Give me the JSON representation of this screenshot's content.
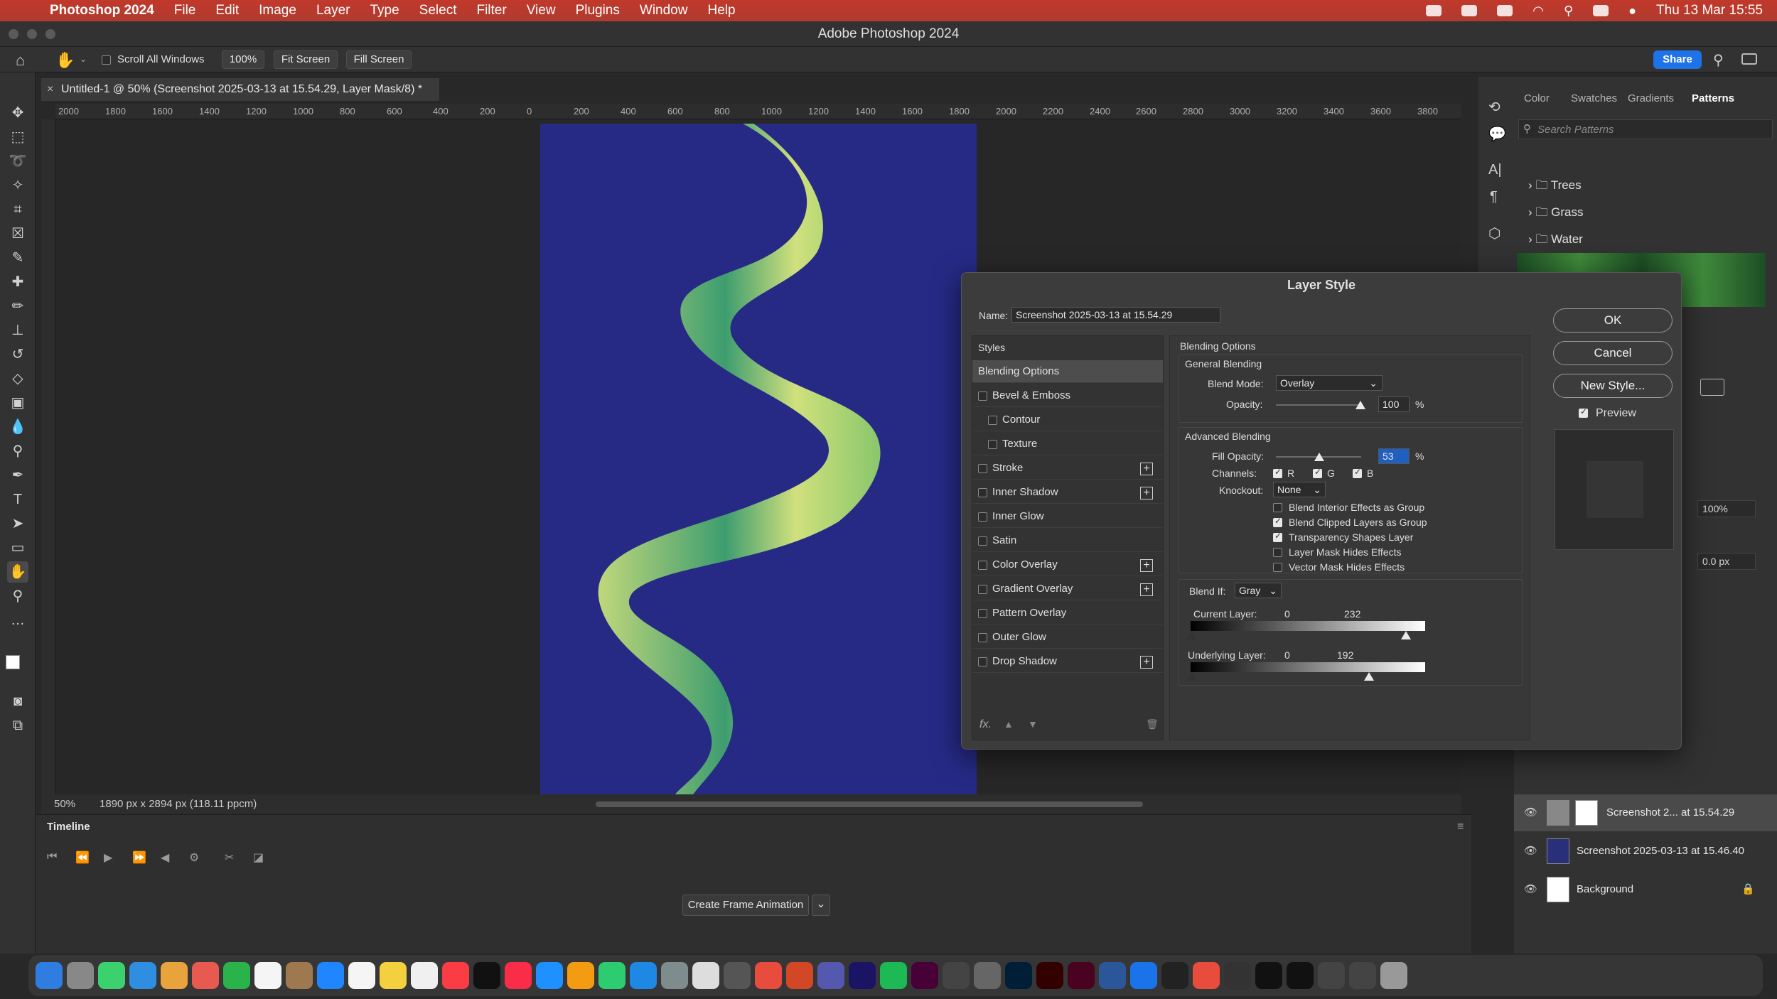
{
  "menubar": {
    "app_name": "Photoshop 2024",
    "menus": [
      "File",
      "Edit",
      "Image",
      "Layer",
      "Type",
      "Select",
      "Filter",
      "View",
      "Plugins",
      "Window",
      "Help"
    ],
    "clock": "Thu 13 Mar  15:55"
  },
  "window": {
    "title": "Adobe Photoshop 2024"
  },
  "options": {
    "scroll_all": "Scroll All Windows",
    "zoom": "100%",
    "fit_screen": "Fit Screen",
    "fill_screen": "Fill Screen",
    "share": "Share"
  },
  "document": {
    "tab_title": "Untitled-1 @ 50% (Screenshot 2025-03-13 at 15.54.29, Layer Mask/8) *",
    "zoom": "50%",
    "dimensions": "1890 px x 2894 px (118.11 ppcm)",
    "ruler_labels": [
      "2000",
      "1800",
      "1600",
      "1400",
      "1200",
      "1000",
      "800",
      "600",
      "400",
      "200",
      "0",
      "200",
      "400",
      "600",
      "800",
      "1000",
      "1200",
      "1400",
      "1600",
      "1800",
      "2000",
      "2200",
      "2400",
      "2600",
      "2800",
      "3000",
      "3200",
      "3400",
      "3600",
      "3800"
    ]
  },
  "timeline": {
    "title": "Timeline",
    "create_button": "Create Frame Animation"
  },
  "patterns_panel": {
    "tabs": [
      "Color",
      "Swatches",
      "Gradients",
      "Patterns"
    ],
    "search_placeholder": "Search Patterns",
    "folders": [
      "Trees",
      "Grass",
      "Water"
    ]
  },
  "properties_panel": {
    "opacity": "100%",
    "feather": "0.0 px"
  },
  "layers": [
    {
      "name": "Screenshot 2... at 15.54.29"
    },
    {
      "name": "Screenshot 2025-03-13 at 15.46.40"
    },
    {
      "name": "Background"
    }
  ],
  "dialog": {
    "title": "Layer Style",
    "name_label": "Name:",
    "name_value": "Screenshot 2025-03-13 at 15.54.29",
    "styles_header": "Styles",
    "styles": [
      {
        "label": "Blending Options",
        "selected": true
      },
      {
        "label": "Bevel & Emboss"
      },
      {
        "label": "Contour"
      },
      {
        "label": "Texture"
      },
      {
        "label": "Stroke"
      },
      {
        "label": "Inner Shadow"
      },
      {
        "label": "Inner Glow"
      },
      {
        "label": "Satin"
      },
      {
        "label": "Color Overlay"
      },
      {
        "label": "Gradient Overlay"
      },
      {
        "label": "Pattern Overlay"
      },
      {
        "label": "Outer Glow"
      },
      {
        "label": "Drop Shadow"
      }
    ],
    "ok": "OK",
    "cancel": "Cancel",
    "new_style": "New Style...",
    "preview": "Preview",
    "blending": {
      "section": "Blending Options",
      "general": "General Blending",
      "blend_mode_label": "Blend Mode:",
      "blend_mode": "Overlay",
      "opacity_label": "Opacity:",
      "opacity": "100",
      "advanced": "Advanced Blending",
      "fill_opacity_label": "Fill Opacity:",
      "fill_opacity": "53",
      "percent": "%",
      "channels_label": "Channels:",
      "channels": [
        "R",
        "G",
        "B"
      ],
      "knockout_label": "Knockout:",
      "knockout": "None",
      "options": [
        {
          "label": "Blend Interior Effects as Group",
          "checked": false
        },
        {
          "label": "Blend Clipped Layers as Group",
          "checked": true
        },
        {
          "label": "Transparency Shapes Layer",
          "checked": true
        },
        {
          "label": "Layer Mask Hides Effects",
          "checked": false
        },
        {
          "label": "Vector Mask Hides Effects",
          "checked": false
        }
      ],
      "blend_if_label": "Blend If:",
      "blend_if": "Gray",
      "current_layer_label": "Current Layer:",
      "current_layer_values": [
        "0",
        "232"
      ],
      "underlying_layer_label": "Underlying Layer:",
      "underlying_layer_values": [
        "0",
        "192"
      ]
    }
  },
  "colors": {
    "menubar": "#b03a2e",
    "artboard": "#262a85",
    "accent": "#1f73e8"
  }
}
